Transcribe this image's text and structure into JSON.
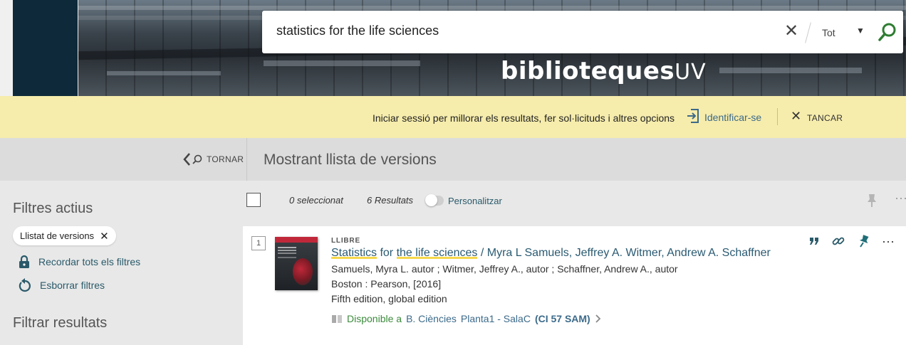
{
  "search": {
    "query": "statistics for the life sciences",
    "scope": "Tot"
  },
  "brand": {
    "logo_main": "biblioteques",
    "logo_suffix": "UV"
  },
  "login_bar": {
    "message": "Iniciar sessió per millorar els resultats, fer sol·licituds i altres opcions",
    "login_label": "Identificar-se",
    "close_label": "TANCAR"
  },
  "nav": {
    "back_label": "TORNAR",
    "page_title": "Mostrant llista de versions"
  },
  "sidebar": {
    "active_filters_heading": "Filtres actius",
    "active_filter_chip": "Llistat de versions",
    "remember_filters": "Recordar tots els filtres",
    "clear_filters": "Esborrar filtres",
    "filter_results_heading": "Filtrar resultats"
  },
  "results_header": {
    "selected": "0 seleccionat",
    "count": "6 Resultats",
    "personalize": "Personalitzar"
  },
  "result": {
    "number": "1",
    "type": "LLIBRE",
    "title_part1": "Statistics",
    "title_part2": " for ",
    "title_part3": "the life sciences",
    "title_rest": " / Myra L Samuels, Jeffrey A. Witmer, Andrew A. Schaffner",
    "authors": "Samuels, Myra L. autor ; Witmer, Jeffrey A., autor ; Schaffner, Andrew A., autor",
    "publication": "Boston : Pearson, [2016]",
    "edition": "Fifth edition, global edition",
    "availability_status": "Disponible a",
    "availability_library": "B. Ciències",
    "availability_location": "Planta1 - SalaC",
    "availability_call": "(CI 57 SAM)"
  },
  "colors": {
    "banner_dark": "#0e2a3a",
    "login_bar": "#f6ecac",
    "link_teal": "#2a5a6a",
    "available_green": "#3c8a3c",
    "highlight": "#f6d84a",
    "search_go": "#2f7d32"
  }
}
